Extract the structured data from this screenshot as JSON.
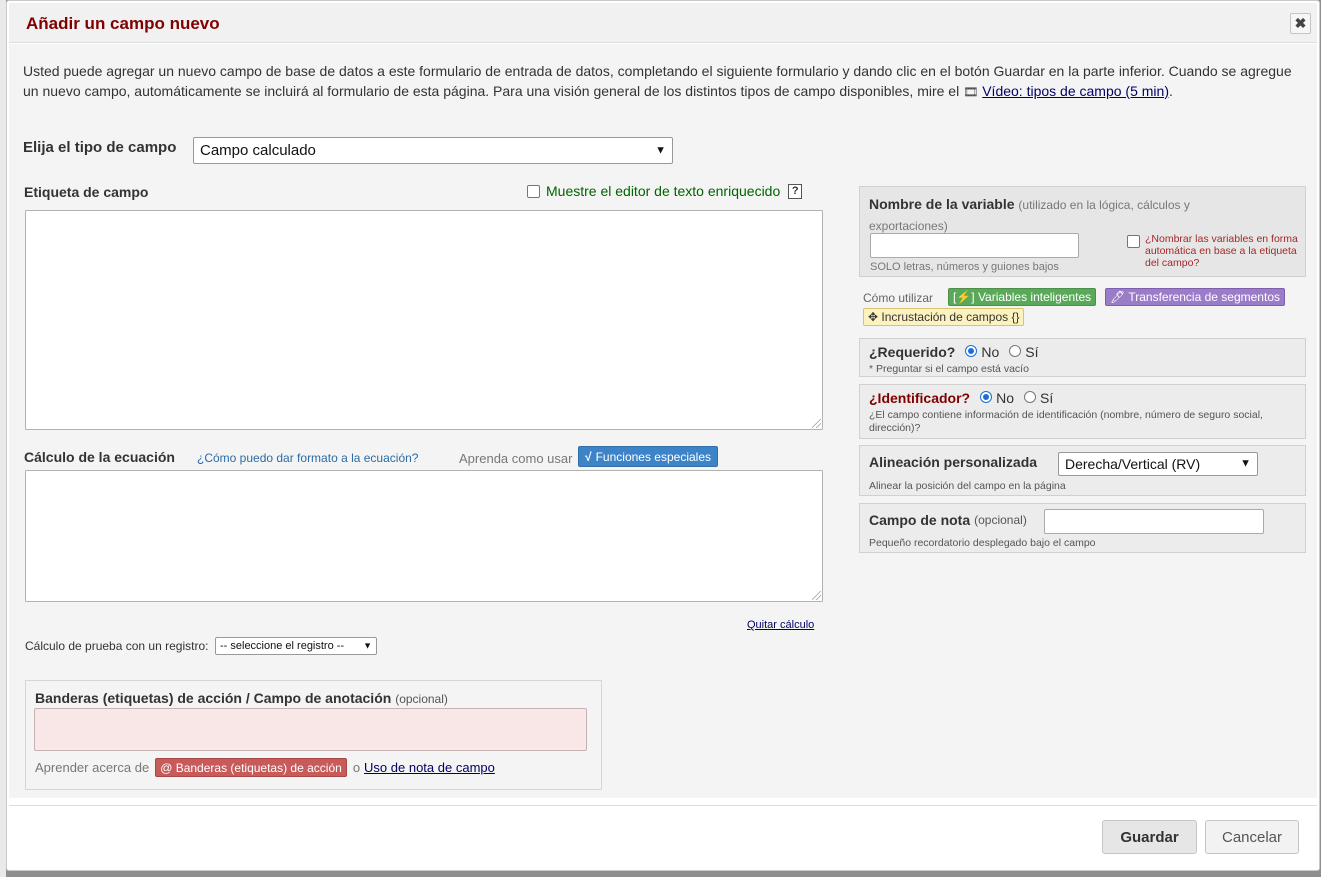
{
  "dialog": {
    "title": "Añadir un campo nuevo",
    "close_glyph": "✖"
  },
  "intro": {
    "text": "Usted puede agregar un nuevo campo de base de datos a este formulario de entrada de datos, completando el siguiente formulario y dando clic en el botón Guardar en la parte inferior. Cuando se agregue un nuevo campo, automáticamente se incluirá al formulario de esta página. Para una visión general de los distintos tipos de campo disponibles, mire el ",
    "video_link": "Vídeo: tipos de campo (5 min)",
    "end": "."
  },
  "field_type": {
    "label": "Elija el tipo de campo",
    "value": "Campo calculado"
  },
  "field_label": {
    "label": "Etiqueta de campo",
    "rich_text": "Muestre el editor de texto enriquecido",
    "help": "?"
  },
  "calc": {
    "label": "Cálculo de la ecuación",
    "help_link": "¿Cómo puedo dar formato a la ecuación?",
    "learn": "Aprenda como usar",
    "special_button": "Funciones especiales",
    "remove_link": "Quitar cálculo",
    "test_label": "Cálculo de prueba con un registro:",
    "test_select": "-- seleccione el registro --"
  },
  "action_tags": {
    "title": "Banderas (etiquetas) de acción / Campo de anotación",
    "optional": "(opcional)",
    "learn": "Aprender acerca de",
    "badge": "@ Banderas (etiquetas) de acción",
    "or": "o",
    "note_link": "Uso de nota de campo"
  },
  "variable": {
    "title": "Nombre de la variable",
    "note": "(utilizado en la lógica, cálculos y exportaciones)",
    "hint": "SOLO letras, números y guiones bajos",
    "auto_name": "¿Nombrar las variables en forma automática en base a la etiqueta del campo?"
  },
  "how_to": {
    "label": "Cómo utilizar",
    "smart_vars": "[⚡] Variables inteligentes",
    "piping": "🖊 Transferencia de segmentos",
    "embedding": "✥ Incrustación de campos {}"
  },
  "required": {
    "title": "¿Requerido?",
    "no": "No",
    "yes": "Sí",
    "sub": "* Preguntar si el campo está vacío"
  },
  "identifier": {
    "title": "¿Identificador?",
    "no": "No",
    "yes": "Sí",
    "sub": "¿El campo contiene información de identificación (nombre, número de seguro social, dirección)?"
  },
  "alignment": {
    "title": "Alineación personalizada",
    "value": "Derecha/Vertical (RV)",
    "sub": "Alinear la posición del campo en la página"
  },
  "field_note": {
    "title": "Campo de nota",
    "optional": "(opcional)",
    "sub": "Pequeño recordatorio desplegado bajo el campo"
  },
  "footer": {
    "save": "Guardar",
    "cancel": "Cancelar"
  },
  "colors": {
    "title": "#800000",
    "special_button": "#3d83c7",
    "smart_vars": "#5aa85a",
    "piping": "#9b7cc8",
    "embedding": "#fbf2bf",
    "action_badge": "#c85a59"
  }
}
